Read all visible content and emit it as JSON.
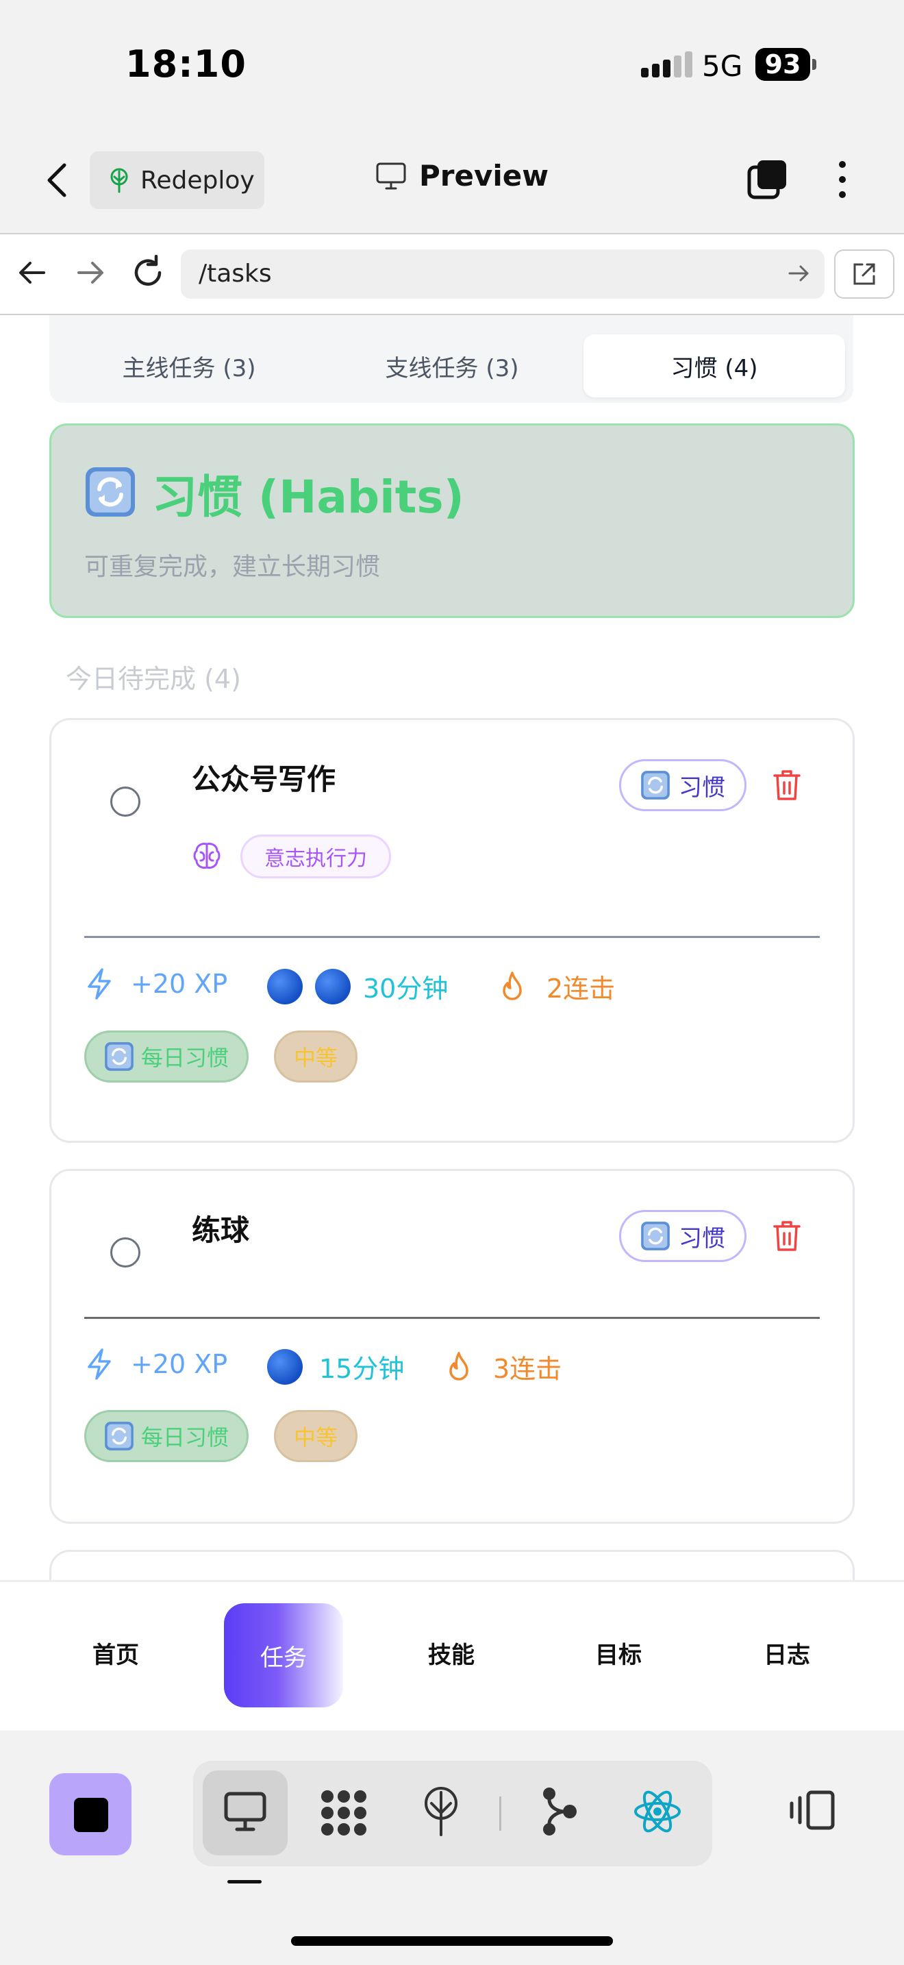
{
  "status_bar": {
    "time": "18:10",
    "network": "5G",
    "battery": "93"
  },
  "app_header": {
    "redeploy_label": "Redeploy",
    "preview_label": "Preview"
  },
  "url_bar": {
    "url": "/tasks"
  },
  "tabs": [
    {
      "label": "主线任务 (3)",
      "active": false
    },
    {
      "label": "支线任务 (3)",
      "active": false
    },
    {
      "label": "习惯 (4)",
      "active": true
    }
  ],
  "banner": {
    "title": "习惯 (Habits)",
    "subtitle": "可重复完成，建立长期习惯"
  },
  "section_label": "今日待完成 (4)",
  "tasks": [
    {
      "title": "公众号写作",
      "type_label": "习惯",
      "skill": "意志执行力",
      "xp": "+20 XP",
      "time": "30分钟",
      "streak": "2连击",
      "tags": [
        "每日习惯",
        "中等"
      ]
    },
    {
      "title": "练球",
      "type_label": "习惯",
      "xp": "+20 XP",
      "time": "15分钟",
      "streak": "3连击",
      "tags": [
        "每日习惯",
        "中等"
      ]
    }
  ],
  "bottom_nav": [
    {
      "label": "首页",
      "active": false
    },
    {
      "label": "任务",
      "active": true
    },
    {
      "label": "技能",
      "active": false
    },
    {
      "label": "目标",
      "active": false
    },
    {
      "label": "日志",
      "active": false
    }
  ],
  "colors": {
    "accent": "#5b3df5",
    "habit_green": "#4ad07b",
    "delete_red": "#ef4444",
    "xp_blue": "#60a5fa",
    "time_cyan": "#22c2d9",
    "streak_orange": "#f08a2c"
  },
  "icons": {
    "status": [
      "signal-icon",
      "battery-icon"
    ],
    "header": [
      "back-icon",
      "tree-icon",
      "monitor-icon",
      "tabs-icon",
      "more-icon"
    ],
    "url": [
      "nav-back-icon",
      "nav-forward-icon",
      "reload-icon",
      "arrow-right-icon",
      "open-external-icon"
    ],
    "task": [
      "refresh-emoji-icon",
      "trash-icon",
      "brain-icon",
      "lightning-icon",
      "blue-circle-icon",
      "fire-icon"
    ],
    "toolbar": [
      "stop-icon",
      "desktop-icon",
      "grid-dots-icon",
      "tree-icon",
      "branch-icon",
      "react-icon",
      "panel-icon"
    ]
  }
}
